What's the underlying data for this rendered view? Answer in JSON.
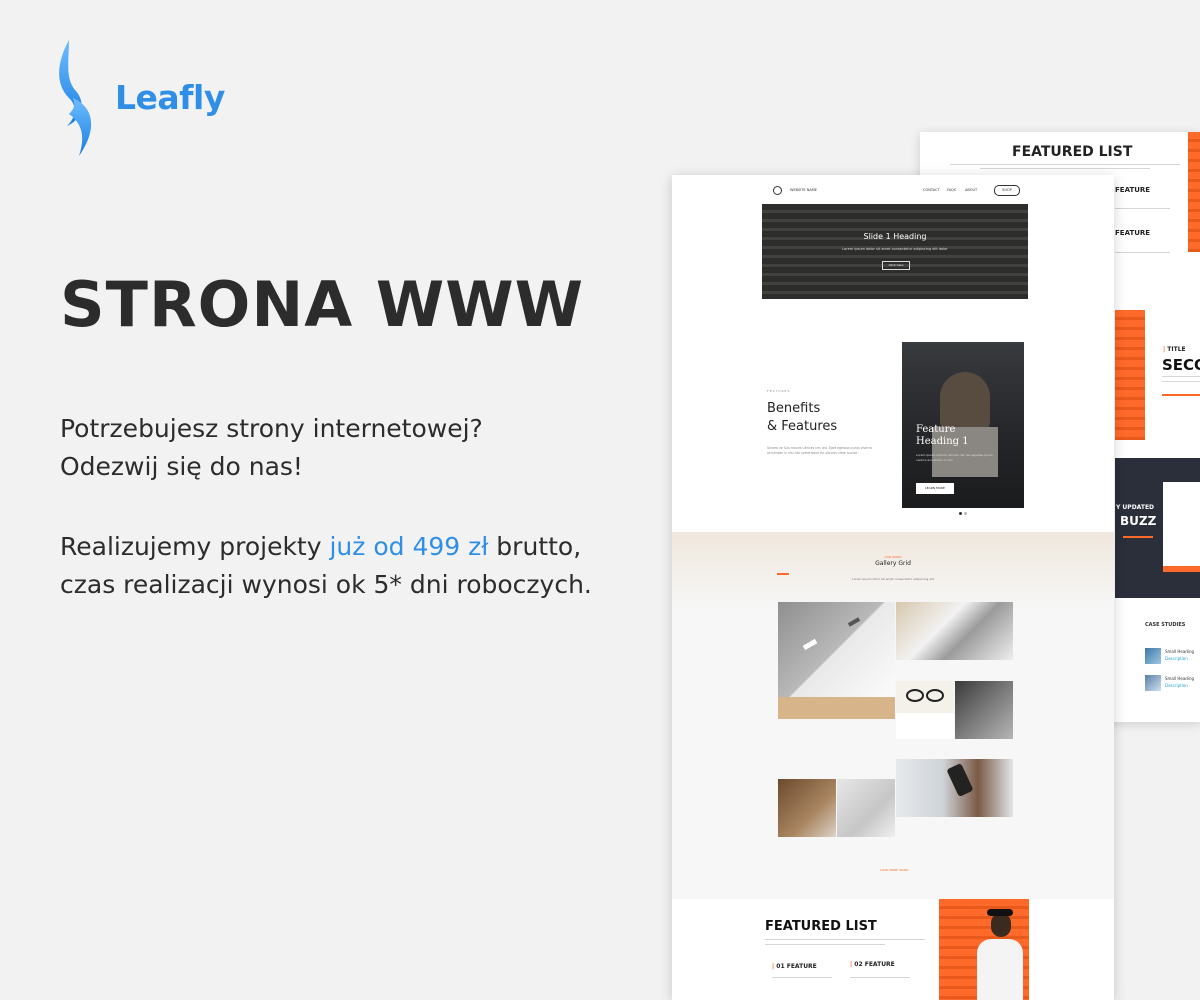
{
  "brand": {
    "name": "Leafly",
    "color": "#2f8fe6"
  },
  "headline": "STRONA WWW",
  "lead": {
    "line1": "Potrzebujesz strony internetowej?",
    "line2": "Odezwij się do nas!"
  },
  "offer": {
    "part1": "Realizujemy projekty ",
    "price": "już od 499 zł",
    "part2": " brutto,",
    "line2": "czas realizacji wynosi ok 5* dni roboczych."
  },
  "mock_front": {
    "nav": {
      "site_name": "WEBSITE NAME",
      "links": [
        "CONTACT",
        "FAQS",
        "ABOUT"
      ],
      "shop": "SHOP"
    },
    "hero": {
      "heading": "Slide 1 Heading",
      "sub": "Lorem ipsum dolor sit amet consectetur adipiscing elit dolor",
      "cta": "Click here"
    },
    "benefits": {
      "eyebrow": "FEATURES",
      "title_line1": "Benefits",
      "title_line2": "& Features",
      "body": "Severo ve Sus mauris ultrices nec leo. Eget egestas purus viverra accumsan in nisl nisi scelerisque eu ultrices vitae auctor."
    },
    "feature_card": {
      "heading_line1": "Feature",
      "heading_line2": "Heading 1",
      "body": "Lorem ipsum mauris ultrices nec leo egestas purus viverra accumsan in nisl",
      "cta": "LEARN MORE"
    },
    "gallery": {
      "eyebrow": "OUR WORK",
      "title": "Gallery Grid",
      "sub": "Lorem ipsum dolor sit amet consectetur adipiscing elit",
      "more": "LOAD MORE WORK"
    },
    "featured": {
      "title": "FEATURED LIST",
      "items": [
        "01 FEATURE",
        "02 FEATURE"
      ]
    }
  },
  "mock_back": {
    "title": "FEATURED LIST",
    "features": [
      "FEATURE",
      "FEATURE"
    ],
    "second": {
      "eyebrow": "TITLE",
      "title": "SECO"
    },
    "stay": {
      "eyebrow": "Y UPDATED",
      "title": "BUZZ"
    },
    "case": {
      "title": "CASE STUDIES",
      "items": [
        {
          "heading": "Small Heading",
          "desc": "Description"
        },
        {
          "heading": "Small Heading",
          "desc": "Description"
        }
      ]
    }
  }
}
